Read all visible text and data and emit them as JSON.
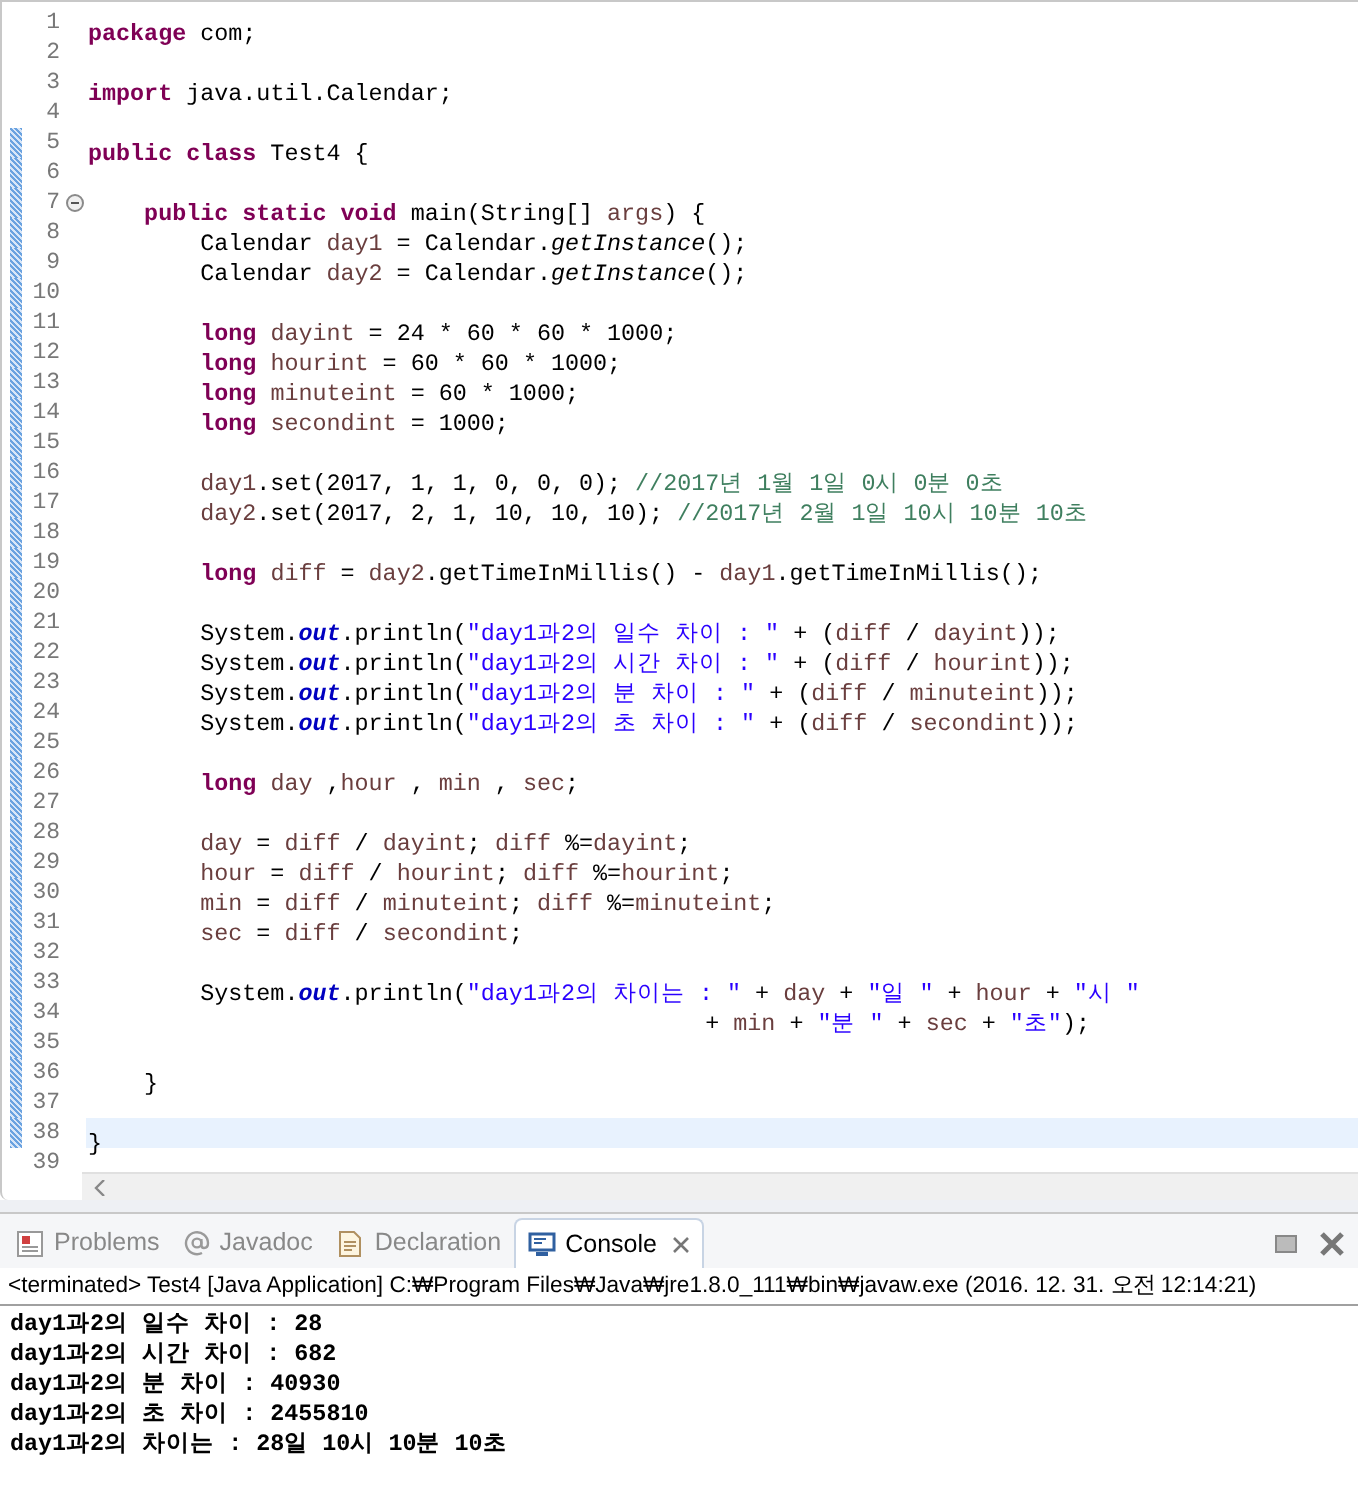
{
  "editor": {
    "lines": [
      {
        "number": "1",
        "changed": false,
        "current": false,
        "fold": false,
        "tokens": [
          {
            "kind": "kw",
            "text": "package"
          },
          {
            "kind": "p",
            "text": " com;"
          }
        ]
      },
      {
        "number": "2",
        "changed": false,
        "current": false,
        "fold": false
      },
      {
        "number": "3",
        "changed": false,
        "current": false,
        "fold": false,
        "tokens": [
          {
            "kind": "kw",
            "text": "import"
          },
          {
            "kind": "p",
            "text": " java.util.Calendar;"
          }
        ]
      },
      {
        "number": "4",
        "changed": false,
        "current": false,
        "fold": false
      },
      {
        "number": "5",
        "changed": true,
        "current": false,
        "fold": false,
        "tokens": [
          {
            "kind": "kw",
            "text": "public class"
          },
          {
            "kind": "p",
            "text": " Test4 {"
          }
        ]
      },
      {
        "number": "6",
        "changed": true,
        "current": false,
        "fold": false
      },
      {
        "number": "7",
        "changed": true,
        "current": false,
        "fold": true,
        "tokens": [
          {
            "kind": "kw",
            "text": "    public static void"
          },
          {
            "kind": "p",
            "text": " main(String[] "
          },
          {
            "kind": "v",
            "text": "args"
          },
          {
            "kind": "p",
            "text": ") {"
          }
        ]
      },
      {
        "number": "8",
        "changed": true,
        "current": false,
        "fold": false,
        "tokens": [
          {
            "kind": "p",
            "text": "        Calendar "
          },
          {
            "kind": "v",
            "text": "day1"
          },
          {
            "kind": "p",
            "text": " = Calendar."
          },
          {
            "kind": "sm",
            "text": "getInstance"
          },
          {
            "kind": "p",
            "text": "();"
          }
        ]
      },
      {
        "number": "9",
        "changed": true,
        "current": false,
        "fold": false,
        "tokens": [
          {
            "kind": "p",
            "text": "        Calendar "
          },
          {
            "kind": "v",
            "text": "day2"
          },
          {
            "kind": "p",
            "text": " = Calendar."
          },
          {
            "kind": "sm",
            "text": "getInstance"
          },
          {
            "kind": "p",
            "text": "();"
          }
        ]
      },
      {
        "number": "10",
        "changed": true,
        "current": false,
        "fold": false
      },
      {
        "number": "11",
        "changed": true,
        "current": false,
        "fold": false,
        "tokens": [
          {
            "kind": "kw",
            "text": "        long "
          },
          {
            "kind": "v",
            "text": "dayint"
          },
          {
            "kind": "p",
            "text": " = 24 * 60 * 60 * 1000;"
          }
        ]
      },
      {
        "number": "12",
        "changed": true,
        "current": false,
        "fold": false,
        "tokens": [
          {
            "kind": "kw",
            "text": "        long "
          },
          {
            "kind": "v",
            "text": "hourint"
          },
          {
            "kind": "p",
            "text": " = 60 * 60 * 1000;"
          }
        ]
      },
      {
        "number": "13",
        "changed": true,
        "current": false,
        "fold": false,
        "tokens": [
          {
            "kind": "kw",
            "text": "        long "
          },
          {
            "kind": "v",
            "text": "minuteint"
          },
          {
            "kind": "p",
            "text": " = 60 * 1000;"
          }
        ]
      },
      {
        "number": "14",
        "changed": true,
        "current": false,
        "fold": false,
        "tokens": [
          {
            "kind": "kw",
            "text": "        long "
          },
          {
            "kind": "v",
            "text": "secondint"
          },
          {
            "kind": "p",
            "text": " = 1000;"
          }
        ]
      },
      {
        "number": "15",
        "changed": true,
        "current": false,
        "fold": false
      },
      {
        "number": "16",
        "changed": true,
        "current": false,
        "fold": false,
        "tokens": [
          {
            "kind": "v",
            "text": "        day1"
          },
          {
            "kind": "p",
            "text": ".set(2017, 1, 1, 0, 0, 0); "
          },
          {
            "kind": "c",
            "text": "//2017년 1월 1일 0시 0분 0초"
          }
        ]
      },
      {
        "number": "17",
        "changed": true,
        "current": false,
        "fold": false,
        "tokens": [
          {
            "kind": "v",
            "text": "        day2"
          },
          {
            "kind": "p",
            "text": ".set(2017, 2, 1, 10, 10, 10); "
          },
          {
            "kind": "c",
            "text": "//2017년 2월 1일 10시 10분 10초"
          }
        ]
      },
      {
        "number": "18",
        "changed": true,
        "current": false,
        "fold": false
      },
      {
        "number": "19",
        "changed": true,
        "current": false,
        "fold": false,
        "tokens": [
          {
            "kind": "kw",
            "text": "        long "
          },
          {
            "kind": "v",
            "text": "diff"
          },
          {
            "kind": "p",
            "text": " = "
          },
          {
            "kind": "v",
            "text": "day2"
          },
          {
            "kind": "p",
            "text": ".getTimeInMillis() - "
          },
          {
            "kind": "v",
            "text": "day1"
          },
          {
            "kind": "p",
            "text": ".getTimeInMillis();"
          }
        ]
      },
      {
        "number": "20",
        "changed": true,
        "current": false,
        "fold": false
      },
      {
        "number": "21",
        "changed": true,
        "current": false,
        "fold": false,
        "tokens": [
          {
            "kind": "p",
            "text": "        System."
          },
          {
            "kind": "sf",
            "text": "out"
          },
          {
            "kind": "p",
            "text": ".println("
          },
          {
            "kind": "s",
            "text": "\"day1과2의 일수 차이 : \""
          },
          {
            "kind": "p",
            "text": " + ("
          },
          {
            "kind": "v",
            "text": "diff"
          },
          {
            "kind": "p",
            "text": " / "
          },
          {
            "kind": "v",
            "text": "dayint"
          },
          {
            "kind": "p",
            "text": "));"
          }
        ]
      },
      {
        "number": "22",
        "changed": true,
        "current": false,
        "fold": false,
        "tokens": [
          {
            "kind": "p",
            "text": "        System."
          },
          {
            "kind": "sf",
            "text": "out"
          },
          {
            "kind": "p",
            "text": ".println("
          },
          {
            "kind": "s",
            "text": "\"day1과2의 시간 차이 : \""
          },
          {
            "kind": "p",
            "text": " + ("
          },
          {
            "kind": "v",
            "text": "diff"
          },
          {
            "kind": "p",
            "text": " / "
          },
          {
            "kind": "v",
            "text": "hourint"
          },
          {
            "kind": "p",
            "text": "));"
          }
        ]
      },
      {
        "number": "23",
        "changed": true,
        "current": false,
        "fold": false,
        "tokens": [
          {
            "kind": "p",
            "text": "        System."
          },
          {
            "kind": "sf",
            "text": "out"
          },
          {
            "kind": "p",
            "text": ".println("
          },
          {
            "kind": "s",
            "text": "\"day1과2의 분 차이 : \""
          },
          {
            "kind": "p",
            "text": " + ("
          },
          {
            "kind": "v",
            "text": "diff"
          },
          {
            "kind": "p",
            "text": " / "
          },
          {
            "kind": "v",
            "text": "minuteint"
          },
          {
            "kind": "p",
            "text": "));"
          }
        ]
      },
      {
        "number": "24",
        "changed": true,
        "current": false,
        "fold": false,
        "tokens": [
          {
            "kind": "p",
            "text": "        System."
          },
          {
            "kind": "sf",
            "text": "out"
          },
          {
            "kind": "p",
            "text": ".println("
          },
          {
            "kind": "s",
            "text": "\"day1과2의 초 차이 : \""
          },
          {
            "kind": "p",
            "text": " + ("
          },
          {
            "kind": "v",
            "text": "diff"
          },
          {
            "kind": "p",
            "text": " / "
          },
          {
            "kind": "v",
            "text": "secondint"
          },
          {
            "kind": "p",
            "text": "));"
          }
        ]
      },
      {
        "number": "25",
        "changed": true,
        "current": false,
        "fold": false
      },
      {
        "number": "26",
        "changed": true,
        "current": false,
        "fold": false,
        "tokens": [
          {
            "kind": "kw",
            "text": "        long "
          },
          {
            "kind": "v",
            "text": "day"
          },
          {
            "kind": "p",
            "text": " ,"
          },
          {
            "kind": "v",
            "text": "hour"
          },
          {
            "kind": "p",
            "text": " , "
          },
          {
            "kind": "v",
            "text": "min"
          },
          {
            "kind": "p",
            "text": " , "
          },
          {
            "kind": "v",
            "text": "sec"
          },
          {
            "kind": "p",
            "text": ";"
          }
        ]
      },
      {
        "number": "27",
        "changed": true,
        "current": false,
        "fold": false
      },
      {
        "number": "28",
        "changed": true,
        "current": false,
        "fold": false,
        "tokens": [
          {
            "kind": "v",
            "text": "        day"
          },
          {
            "kind": "p",
            "text": " = "
          },
          {
            "kind": "v",
            "text": "diff"
          },
          {
            "kind": "p",
            "text": " / "
          },
          {
            "kind": "v",
            "text": "dayint"
          },
          {
            "kind": "p",
            "text": "; "
          },
          {
            "kind": "v",
            "text": "diff"
          },
          {
            "kind": "p",
            "text": " %="
          },
          {
            "kind": "v",
            "text": "dayint"
          },
          {
            "kind": "p",
            "text": ";"
          }
        ]
      },
      {
        "number": "29",
        "changed": true,
        "current": false,
        "fold": false,
        "tokens": [
          {
            "kind": "v",
            "text": "        hour"
          },
          {
            "kind": "p",
            "text": " = "
          },
          {
            "kind": "v",
            "text": "diff"
          },
          {
            "kind": "p",
            "text": " / "
          },
          {
            "kind": "v",
            "text": "hourint"
          },
          {
            "kind": "p",
            "text": "; "
          },
          {
            "kind": "v",
            "text": "diff"
          },
          {
            "kind": "p",
            "text": " %="
          },
          {
            "kind": "v",
            "text": "hourint"
          },
          {
            "kind": "p",
            "text": ";"
          }
        ]
      },
      {
        "number": "30",
        "changed": true,
        "current": false,
        "fold": false,
        "tokens": [
          {
            "kind": "v",
            "text": "        min"
          },
          {
            "kind": "p",
            "text": " = "
          },
          {
            "kind": "v",
            "text": "diff"
          },
          {
            "kind": "p",
            "text": " / "
          },
          {
            "kind": "v",
            "text": "minuteint"
          },
          {
            "kind": "p",
            "text": "; "
          },
          {
            "kind": "v",
            "text": "diff"
          },
          {
            "kind": "p",
            "text": " %="
          },
          {
            "kind": "v",
            "text": "minuteint"
          },
          {
            "kind": "p",
            "text": ";"
          }
        ]
      },
      {
        "number": "31",
        "changed": true,
        "current": false,
        "fold": false,
        "tokens": [
          {
            "kind": "v",
            "text": "        sec"
          },
          {
            "kind": "p",
            "text": " = "
          },
          {
            "kind": "v",
            "text": "diff"
          },
          {
            "kind": "p",
            "text": " / "
          },
          {
            "kind": "v",
            "text": "secondint"
          },
          {
            "kind": "p",
            "text": ";"
          }
        ]
      },
      {
        "number": "32",
        "changed": true,
        "current": false,
        "fold": false
      },
      {
        "number": "33",
        "changed": true,
        "current": false,
        "fold": false,
        "tokens": [
          {
            "kind": "p",
            "text": "        System."
          },
          {
            "kind": "sf",
            "text": "out"
          },
          {
            "kind": "p",
            "text": ".println("
          },
          {
            "kind": "s",
            "text": "\"day1과2의 차이는 : \""
          },
          {
            "kind": "p",
            "text": " + "
          },
          {
            "kind": "v",
            "text": "day"
          },
          {
            "kind": "p",
            "text": " + "
          },
          {
            "kind": "s",
            "text": "\"일 \""
          },
          {
            "kind": "p",
            "text": " + "
          },
          {
            "kind": "v",
            "text": "hour"
          },
          {
            "kind": "p",
            "text": " + "
          },
          {
            "kind": "s",
            "text": "\"시 \""
          }
        ]
      },
      {
        "number": "34",
        "changed": true,
        "current": false,
        "fold": false,
        "tokens": [
          {
            "kind": "p",
            "text": "                                            + "
          },
          {
            "kind": "v",
            "text": "min"
          },
          {
            "kind": "p",
            "text": " + "
          },
          {
            "kind": "s",
            "text": "\"분 \""
          },
          {
            "kind": "p",
            "text": " + "
          },
          {
            "kind": "v",
            "text": "sec"
          },
          {
            "kind": "p",
            "text": " + "
          },
          {
            "kind": "s",
            "text": "\"초\""
          },
          {
            "kind": "p",
            "text": ");"
          }
        ]
      },
      {
        "number": "35",
        "changed": true,
        "current": false,
        "fold": false
      },
      {
        "number": "36",
        "changed": true,
        "current": false,
        "fold": false,
        "tokens": [
          {
            "kind": "p",
            "text": "    }"
          }
        ]
      },
      {
        "number": "37",
        "changed": true,
        "current": false,
        "fold": false
      },
      {
        "number": "38",
        "changed": true,
        "current": true,
        "fold": false,
        "tokens": [
          {
            "kind": "p",
            "text": "}"
          }
        ]
      },
      {
        "number": "39",
        "changed": false,
        "current": false,
        "fold": false
      }
    ]
  },
  "console": {
    "tabs": [
      {
        "label": "Problems",
        "kind": "problems",
        "selected": false
      },
      {
        "label": "Javadoc",
        "kind": "javadoc",
        "selected": false
      },
      {
        "label": "Declaration",
        "kind": "declaration",
        "selected": false
      },
      {
        "label": "Console",
        "kind": "console",
        "selected": true
      }
    ],
    "header": "<terminated> Test4 [Java Application] C:₩Program Files₩Java₩jre1.8.0_111₩bin₩javaw.exe (2016. 12. 31. 오전 12:14:21)",
    "output": [
      "day1과2의 일수 차이 : 28",
      "day1과2의 시간 차이 : 682",
      "day1과2의 분 차이 : 40930",
      "day1과2의 초 차이 : 2455810",
      "day1과2의 차이는 : 28일 10시 10분 10초"
    ]
  }
}
